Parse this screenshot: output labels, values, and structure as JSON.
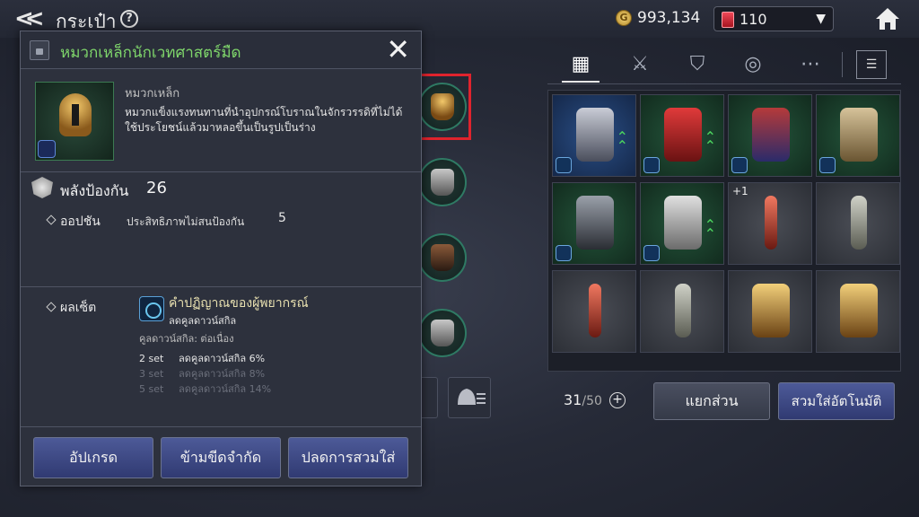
{
  "topbar": {
    "back_icon": "double-chevron-left-icon",
    "title": "กระเป๋า",
    "help_label": "?",
    "gold_icon_label": "G",
    "gold": "993,134",
    "gems": "110",
    "home_icon": "home-icon"
  },
  "item": {
    "name": "หมวกเหล็กนักเวทศาสตร์มืด",
    "type": "หมวกเหล็ก",
    "description": "หมวกแข็งแรงทนทานที่นำอุปกรณ์โบราณในจักรวรรดิที่ไม่ได้ใช้ประโยชน์แล้วมาหลอขึ้นเป็นรูปเป็นร่าง",
    "defense_label": "พลังป้องกัน",
    "defense_value": "26",
    "option_label": "ออปชัน",
    "option_name": "ประสิทธิภาพไม่สนป้องกัน",
    "option_value": "5",
    "set_label": "ผลเซ็ต",
    "set_name": "คำปฏิญาณของผู้พยากรณ์",
    "set_sub": "ลดคูลดาวน์สกิล",
    "set_cooldown": "คูลดาวน์สกิล: ต่อเนื่อง",
    "set_bonuses": [
      {
        "count": "2 set",
        "effect": "ลดคูลดาวน์สกิล 6%",
        "active": true
      },
      {
        "count": "3 set",
        "effect": "ลดคูลดาวน์สกิล 8%",
        "active": false
      },
      {
        "count": "5 set",
        "effect": "ลดคูลดาวน์สกิล 14%",
        "active": false
      }
    ],
    "buttons": {
      "upgrade": "อัปเกรด",
      "limit_break": "ข้ามขีดจำกัด",
      "unequip": "ปลดการสวมใส่"
    }
  },
  "inventory": {
    "tabs": [
      "all-grid-icon",
      "crossed-swords-icon",
      "shield-icon",
      "ring-icon",
      "more-icon"
    ],
    "sort_icon": "sort-icon",
    "items": [
      {
        "name": "gauntlet",
        "frame": "blue",
        "upgrade": true,
        "enhance": ""
      },
      {
        "name": "staff",
        "frame": "green",
        "upgrade": true,
        "enhance": ""
      },
      {
        "name": "chest-armor",
        "frame": "green",
        "upgrade": false,
        "enhance": ""
      },
      {
        "name": "robe",
        "frame": "green",
        "upgrade": false,
        "enhance": ""
      },
      {
        "name": "gloves",
        "frame": "green",
        "upgrade": false,
        "enhance": ""
      },
      {
        "name": "ring",
        "frame": "green",
        "upgrade": true,
        "enhance": ""
      },
      {
        "name": "sword",
        "frame": "plain",
        "upgrade": false,
        "enhance": "+1"
      },
      {
        "name": "bow",
        "frame": "plain",
        "upgrade": false,
        "enhance": ""
      },
      {
        "name": "sword",
        "frame": "plain",
        "upgrade": false,
        "enhance": ""
      },
      {
        "name": "bow",
        "frame": "plain",
        "upgrade": false,
        "enhance": ""
      },
      {
        "name": "golden-shield",
        "frame": "plain",
        "upgrade": false,
        "enhance": ""
      },
      {
        "name": "golden-shield",
        "frame": "plain",
        "upgrade": false,
        "enhance": ""
      }
    ],
    "count": "31",
    "capacity": "/50",
    "dismantle_label": "แยกส่วน",
    "auto_equip_label": "สวมใส่อัตโนมัติ"
  }
}
